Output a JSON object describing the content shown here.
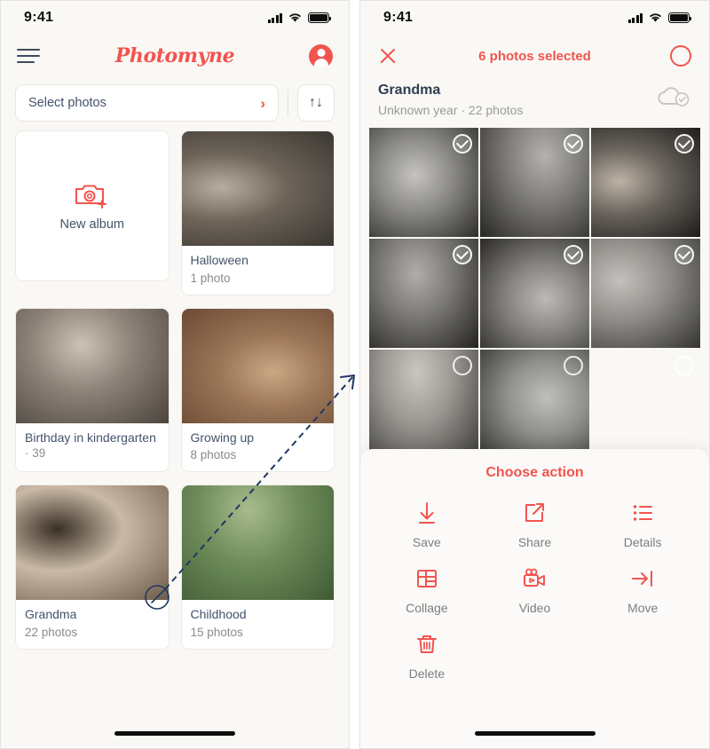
{
  "status_bar": {
    "time": "9:41",
    "signal_icon": "signal-bars-icon",
    "wifi_icon": "wifi-icon",
    "battery_icon": "battery-full-icon"
  },
  "left_screen": {
    "header": {
      "menu_icon": "hamburger-menu-icon",
      "brand": "Photomyne",
      "avatar_icon": "account-avatar-icon"
    },
    "select_bar": {
      "label": "Select photos",
      "chevron_icon": "chevron-right-icon",
      "sort_icon": "sort-arrows-icon",
      "sort_glyph": "↑↓"
    },
    "new_album": {
      "label": "New album",
      "icon": "camera-plus-icon"
    },
    "albums": [
      {
        "title": "Halloween",
        "count": "1 photo",
        "inline_count": null,
        "colors": [
          "#6d6459",
          "#3a3530",
          "#b9ada0"
        ]
      },
      {
        "title": "Birthday in kindergarten",
        "count": null,
        "inline_count": "·  39",
        "colors": [
          "#8d8278",
          "#4b443d",
          "#cdc2b6"
        ]
      },
      {
        "title": "Growing up",
        "count": "8 photos",
        "inline_count": null,
        "colors": [
          "#9a7557",
          "#6b4a33",
          "#c9a884"
        ]
      },
      {
        "title": "Grandma",
        "count": "22 photos",
        "inline_count": null,
        "colors": [
          "#c9b9a6",
          "#6b5a48",
          "#3a2f26"
        ]
      },
      {
        "title": "Childhood",
        "count": "15 photos",
        "inline_count": null,
        "colors": [
          "#6f8d5a",
          "#3f5a34",
          "#a9bb8e"
        ]
      }
    ]
  },
  "right_screen": {
    "header": {
      "close_icon": "close-x-icon",
      "title": "6 photos selected",
      "select_all_icon": "select-all-circle-icon"
    },
    "album_info": {
      "name": "Grandma",
      "subtitle": "Unknown year  ·  22 photos",
      "cloud_icon": "cloud-synced-icon"
    },
    "photos": [
      {
        "selected": true,
        "colors": [
          "#8b8a86",
          "#2e2d2b",
          "#c6c4bf"
        ]
      },
      {
        "selected": true,
        "colors": [
          "#7d7b77",
          "#272624",
          "#b4b2ad"
        ]
      },
      {
        "selected": true,
        "colors": [
          "#6a645d",
          "#1d1b19",
          "#bdb3a7"
        ]
      },
      {
        "selected": true,
        "colors": [
          "#7a7874",
          "#232220",
          "#b0aea9"
        ]
      },
      {
        "selected": true,
        "colors": [
          "#85837f",
          "#2a2927",
          "#bcbab5"
        ]
      },
      {
        "selected": true,
        "colors": [
          "#8f8d88",
          "#34332f",
          "#c3c1bc"
        ]
      },
      {
        "selected": false,
        "colors": [
          "#9a9792",
          "#3b3a36",
          "#cac7c1"
        ]
      },
      {
        "selected": false,
        "colors": [
          "#90908c",
          "#313130",
          "#c0c0bb"
        ]
      },
      {
        "selected": false,
        "colors": [
          "#b4a header",
          "#4a413a",
          "#d2c6b8"
        ]
      }
    ],
    "action_sheet": {
      "title": "Choose action",
      "actions": [
        {
          "label": "Save",
          "icon": "download-arrow-icon"
        },
        {
          "label": "Share",
          "icon": "share-box-arrow-icon"
        },
        {
          "label": "Details",
          "icon": "details-list-icon"
        },
        {
          "label": "Collage",
          "icon": "collage-grid-icon"
        },
        {
          "label": "Video",
          "icon": "video-camera-icon"
        },
        {
          "label": "Move",
          "icon": "move-arrow-bar-icon"
        },
        {
          "label": "Delete",
          "icon": "trash-delete-icon"
        }
      ]
    }
  },
  "annotation": {
    "marker_icon": "tap-target-circle-icon",
    "arrow_icon": "dashed-flow-arrow-icon",
    "color": "#1f3864"
  }
}
